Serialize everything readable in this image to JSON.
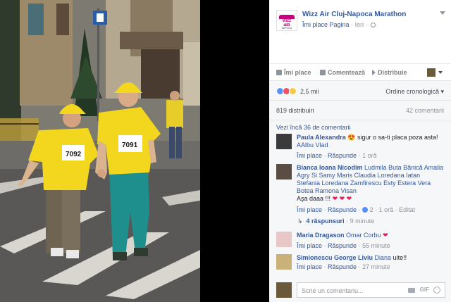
{
  "post": {
    "page_name": "Wizz Air Cluj-Napoca Marathon",
    "page_like_link": "Îmi place Pagina",
    "separator": "·",
    "time": "Ieri",
    "logo_text": "WIZZ AIR",
    "logo_subtext": "CLUJ-NAPOCA"
  },
  "photo": {
    "bib_left": "7092",
    "bib_right": "7091"
  },
  "actions": {
    "like": "Îmi place",
    "comment": "Comentează",
    "share": "Distribuie"
  },
  "reactions": {
    "count": "2,5 mii",
    "order": "Ordine cronologică"
  },
  "stats": {
    "shares": "819 distribuiri",
    "comments": "42 comentarii"
  },
  "comments": {
    "more_link": "Vezi încă 36 de comentarii",
    "items": [
      {
        "author": "Paula Alexandra",
        "emoji": "😍",
        "text": "sigur o sa-ti placa poza asta!",
        "line2_tag": "AAlbu Vlad",
        "like": "Îmi place",
        "reply": "Răspunde",
        "time": "1 oră"
      },
      {
        "author": "Bianca Ioana Nicodim",
        "tags": "Ludmila Buta Bănică Amalia Agry Si Samy Maris Claudia Loredana Iatan Stefania Loredana Zamfirescu Esty Estera Vera Botea Ramona Visan",
        "text": "Aşa daaa !!!",
        "hearts": "❤ ❤ ❤",
        "like": "Îmi place",
        "reply": "Răspunde",
        "reaction_count": "2",
        "time": "1 oră",
        "edited": "Editat",
        "replies": "4 răspunsuri",
        "replies_time": "9 minute"
      },
      {
        "author": "Maria Dragason",
        "tag": "Omar Corbu",
        "heart": "❤",
        "like": "Îmi place",
        "reply": "Răspunde",
        "time": "55 minute"
      },
      {
        "author": "Simionescu George Liviu",
        "tag": "Diana",
        "text": "uite!!",
        "like": "Îmi place",
        "reply": "Răspunde",
        "time": "27 minute"
      }
    ]
  },
  "composer": {
    "placeholder": "Scrie un comentariu...",
    "gif_label": "GIF"
  },
  "colors": {
    "link": "#365899",
    "muted": "#90949c",
    "background": "#f6f7f9",
    "shirt": "#f2d71e",
    "pants": "#1f8f8e"
  },
  "icons": [
    "like-icon",
    "comment-icon",
    "share-icon",
    "camera-icon",
    "smiley-icon",
    "globe-icon",
    "chevron-down-icon",
    "reply-arrow-icon"
  ]
}
